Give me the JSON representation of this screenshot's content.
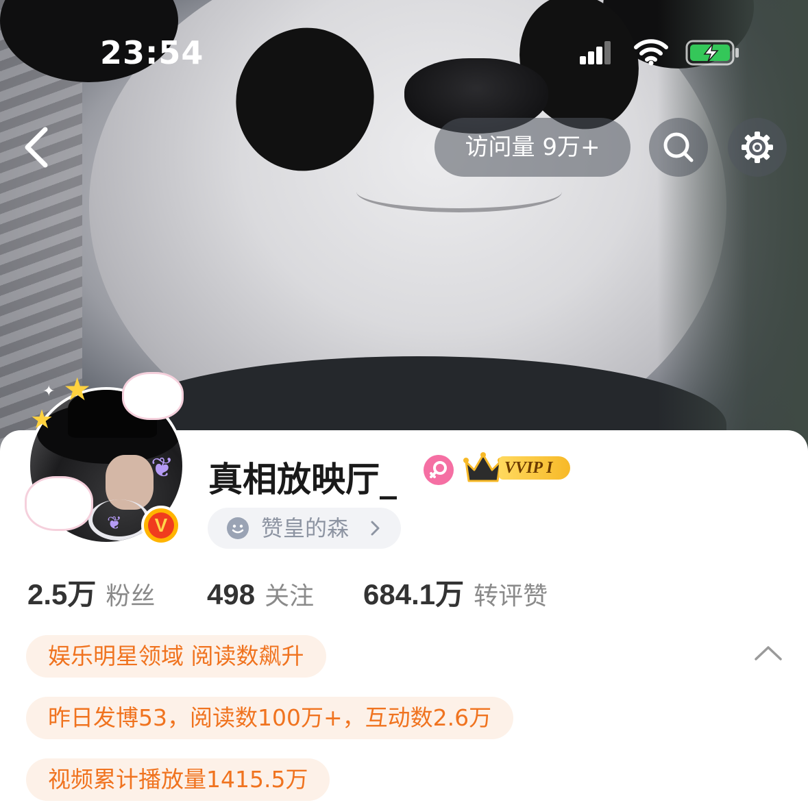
{
  "status_bar": {
    "time": "23:54"
  },
  "nav": {
    "visits_label": "访问量 9万+"
  },
  "profile": {
    "username": "真相放映厅_",
    "vip_label": "VVIP I",
    "verified_badge": "V",
    "group_link": "赞皇的森"
  },
  "stats": [
    {
      "value": "2.5万",
      "label": "粉丝"
    },
    {
      "value": "498",
      "label": "关注"
    },
    {
      "value": "684.1万",
      "label": "转评赞"
    }
  ],
  "tags": [
    "娱乐明星领域 阅读数飙升",
    "昨日发博53，阅读数100万+，互动数2.6万",
    "视频累计播放量1415.5万"
  ],
  "icons": {
    "back": "chevron-left-icon",
    "search": "search-icon",
    "settings": "gear-icon",
    "gender": "female-icon",
    "crown": "crown-icon",
    "collapse": "chevron-up-icon"
  },
  "colors": {
    "tag_text": "#f0731f",
    "tag_bg": "#fdf1e8",
    "gender_pink": "#f56fa3",
    "vip_gold": "#f7b928",
    "battery_green": "#34c759"
  }
}
